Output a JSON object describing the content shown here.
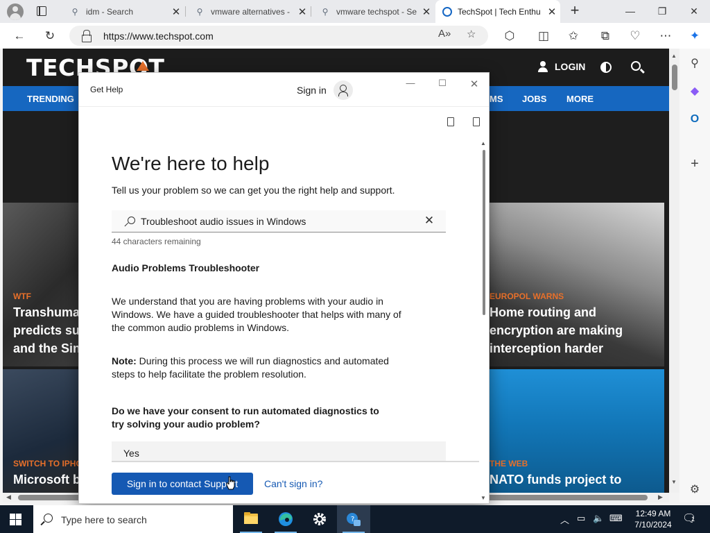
{
  "browser": {
    "tabs": [
      {
        "title": "idm - Search",
        "icon": "search-icon"
      },
      {
        "title": "vmware alternatives - ",
        "icon": "search-icon"
      },
      {
        "title": "vmware techspot - Se",
        "icon": "search-icon"
      },
      {
        "title": "TechSpot | Tech Enthu",
        "icon": "techspot-icon",
        "active": true
      }
    ],
    "url": "https://www.techspot.com"
  },
  "site": {
    "logo": "TECHSPOT",
    "login": "LOGIN",
    "nav": [
      "TRENDING",
      "MS",
      "JOBS",
      "MORE"
    ],
    "cards": [
      {
        "kicker": "WTF",
        "lines": [
          "Transhuman",
          "predicts sup",
          "and the Sing"
        ]
      },
      {
        "kicker": "EUROPOL WARNS",
        "lines": [
          "Home routing and",
          "encryption are making",
          "interception harder"
        ]
      },
      {
        "kicker": "SWITCH TO IPHO",
        "lines": [
          "Microsoft ba"
        ]
      },
      {
        "kicker": "THE WEB",
        "lines": [
          "NATO funds project to"
        ]
      }
    ]
  },
  "dialog": {
    "app_title": "Get Help",
    "sign_in": "Sign in",
    "heading": "We're here to help",
    "subheading": "Tell us your problem so we can get you the right help and support.",
    "search_value": "Troubleshoot audio issues in Windows",
    "chars_remaining": "44 characters remaining",
    "section_title": "Audio Problems Troubleshooter",
    "paragraph1": "We understand that you are having problems with your audio in Windows. We have a guided troubleshooter that helps with many of the common audio problems in Windows.",
    "note_label": "Note:",
    "note_text": " During this process we will run diagnostics and automated steps to help facilitate the problem resolution.",
    "question": "Do we have your consent to run automated diagnostics to try solving your audio problem?",
    "option_yes": "Yes",
    "primary_button": "Sign in to contact Support",
    "link": "Can't sign in?"
  },
  "taskbar": {
    "search_placeholder": "Type here to search",
    "time": "12:49 AM",
    "date": "7/10/2024",
    "notification_count": "1"
  },
  "colors": {
    "techspot_nav": "#1667c0",
    "techspot_accent": "#e8702a",
    "primary_button": "#1559b3",
    "taskbar": "#0f1b2a"
  }
}
